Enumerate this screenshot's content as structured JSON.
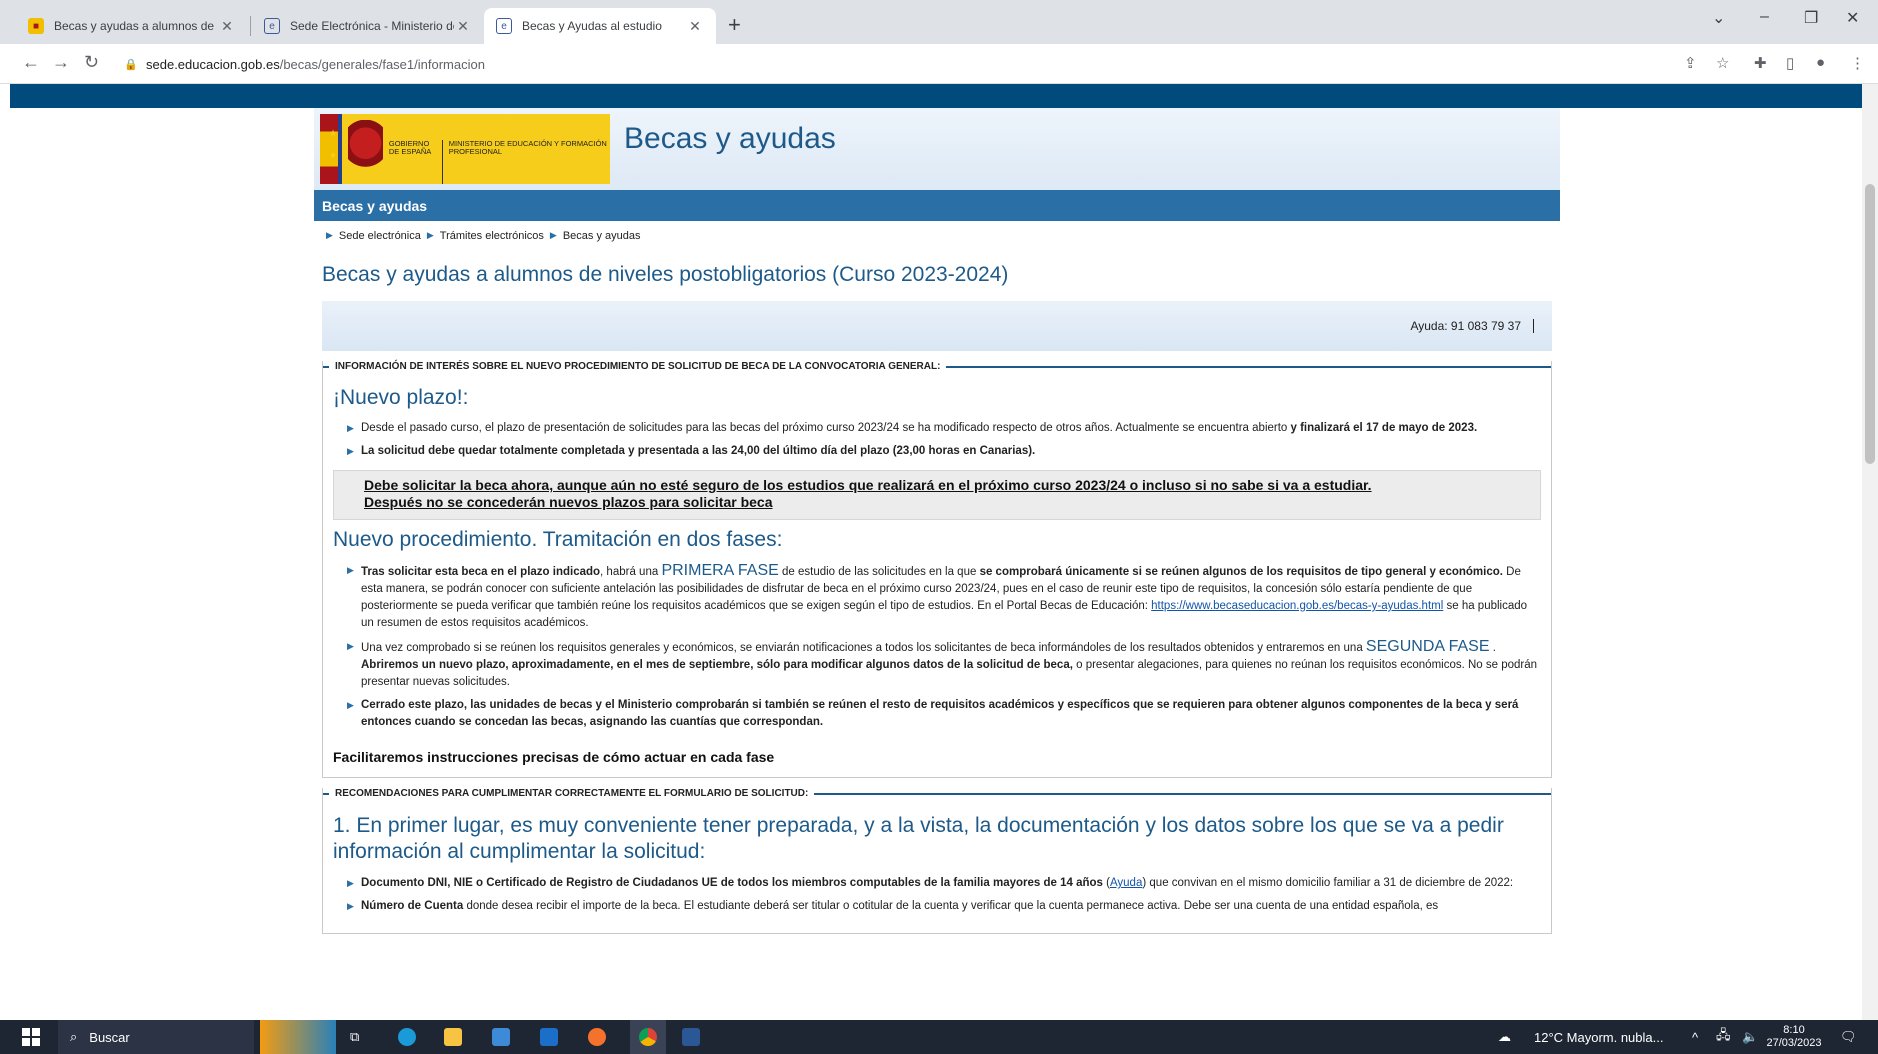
{
  "browser": {
    "tabs": [
      {
        "title": "Becas y ayudas a alumnos de niveles postobligatorios",
        "active": false
      },
      {
        "title": "Sede Electrónica - Ministerio de Educación",
        "active": false
      },
      {
        "title": "Becas y Ayudas al estudio",
        "active": true
      }
    ],
    "url_host": "sede.educacion.gob.es",
    "url_path": "/becas/generales/fase1/informacion"
  },
  "site": {
    "logo_gobierno": "GOBIERNO DE ESPAÑA",
    "logo_ministerio": "MINISTERIO DE EDUCACIÓN Y FORMACIÓN PROFESIONAL",
    "title": "Becas y ayudas",
    "bluebar": "Becas y ayudas",
    "breadcrumb": [
      "Sede electrónica",
      "Trámites electrónicos",
      "Becas y ayudas"
    ],
    "page_title": "Becas y ayudas a alumnos de niveles postobligatorios (Curso 2023-2024)",
    "help": "Ayuda: 91 083 79 37"
  },
  "section1": {
    "legend": "INFORMACIÓN DE INTERÉS SOBRE EL NUEVO PROCEDIMIENTO DE SOLICITUD DE BECA DE LA CONVOCATORIA GENERAL:",
    "heading": "¡Nuevo plazo!:",
    "item1_text": "Desde el pasado curso, el plazo de presentación de solicitudes para las becas del próximo curso 2023/24 se ha modificado respecto de otros años. Actualmente se encuentra abierto ",
    "item1_bold": "y finalizará el 17 de mayo de 2023.",
    "item2_bold": "La solicitud debe quedar totalmente completada y presentada a las 24,00 del último día del plazo (23,00 horas en Canarias).",
    "notice_line1": "Debe solicitar la beca ahora, aunque aún no esté seguro de los estudios que realizará en el próximo curso 2023/24 o incluso si no sabe si va a estudiar.",
    "notice_line2": "Después no se concederán nuevos plazos para solicitar beca",
    "heading2": "Nuevo procedimiento. Tramitación en dos fases:",
    "p1_a": "Tras solicitar esta beca en el plazo indicado",
    "p1_b": ", habrá una ",
    "p1_fase": "PRIMERA FASE",
    "p1_c": " de estudio de las solicitudes en la que ",
    "p1_d": "se comprobará únicamente si se reúnen algunos de los requisitos de tipo general y económico.",
    "p1_e": " De esta manera, se podrán conocer con suficiente antelación las posibilidades de disfrutar de beca en el próximo curso 2023/24, pues en el caso de reunir este tipo de requisitos, la concesión sólo estaría pendiente de que posteriormente se pueda verificar que también reúne los requisitos académicos que se exigen según el tipo de estudios. En el Portal Becas de Educación: ",
    "p1_link": "https://www.becaseducacion.gob.es/becas-y-ayudas.html",
    "p1_f": " se ha publicado un resumen de estos requisitos académicos.",
    "p2_a": "Una vez comprobado si se reúnen los requisitos generales y económicos, se enviarán notificaciones a todos los solicitantes de beca informándoles de los resultados obtenidos y entraremos en una ",
    "p2_fase": "SEGUNDA FASE",
    "p2_b": " . ",
    "p2_c": "Abriremos un nuevo plazo, aproximadamente, en el mes de septiembre, sólo para modificar algunos datos de la solicitud de beca,",
    "p2_d": " o presentar alegaciones, para quienes no reúnan los requisitos económicos. No se podrán presentar nuevas solicitudes.",
    "p3": "Cerrado este plazo, las unidades de becas y el Ministerio comprobarán si también se reúnen el resto de requisitos académicos y específicos que se requieren para obtener algunos componentes de la beca y será entonces cuando se concedan las becas, asignando las cuantías que correspondan.",
    "footnote": "Facilitaremos instrucciones precisas de cómo actuar en cada fase"
  },
  "section2": {
    "legend": "RECOMENDACIONES PARA CUMPLIMENTAR CORRECTAMENTE EL FORMULARIO DE SOLICITUD:",
    "heading": "1. En primer lugar, es muy conveniente tener preparada, y a la vista, la documentación y los datos sobre los que se va a pedir información al cumplimentar la solicitud:",
    "d1_bold": "Documento DNI, NIE o Certificado de Registro de Ciudadanos UE de todos los miembros computables de la familia mayores de 14 años",
    "d1_link": "Ayuda",
    "d1_rest": " que convivan en el mismo domicilio familiar a 31 de diciembre de 2022:",
    "d2_bold": "Número de Cuenta",
    "d2_rest": " donde desea recibir el importe de la beca. El estudiante deberá ser titular o cotitular de la cuenta y verificar que la cuenta permanece activa. Debe ser una cuenta de una entidad española, es"
  },
  "taskbar": {
    "search": "Buscar",
    "weather": "12°C  Mayorm. nubla...",
    "time": "8:10",
    "date": "27/03/2023"
  }
}
